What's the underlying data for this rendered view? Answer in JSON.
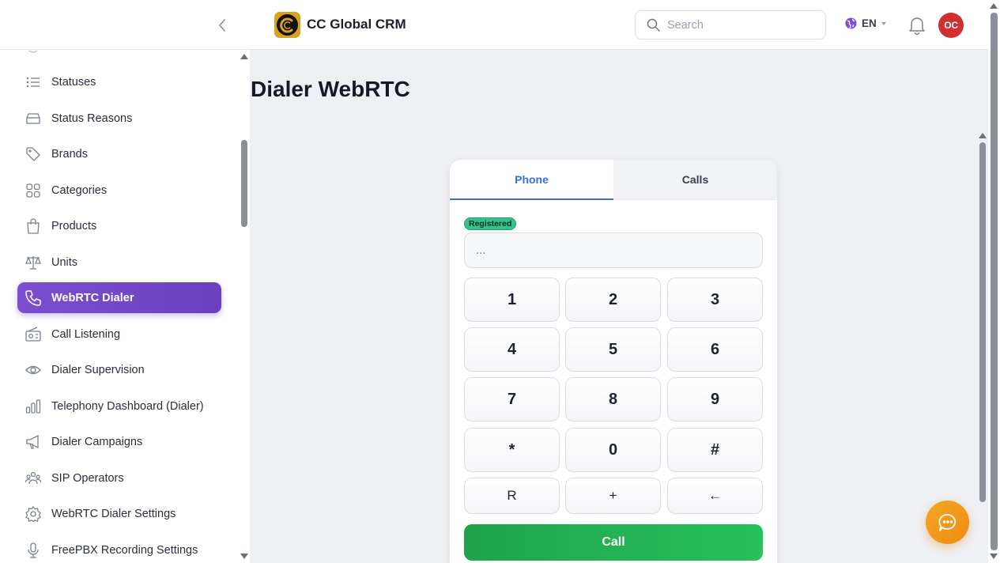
{
  "header": {
    "app_title": "CC Global CRM",
    "search_placeholder": "Search",
    "language": "EN",
    "avatar_initials": "OC"
  },
  "sidebar": {
    "items": [
      {
        "label": "Statuses",
        "icon": "list-icon"
      },
      {
        "label": "Status Reasons",
        "icon": "inbox-icon"
      },
      {
        "label": "Brands",
        "icon": "tag-icon"
      },
      {
        "label": "Categories",
        "icon": "grid-icon"
      },
      {
        "label": "Products",
        "icon": "shopping-bag-icon"
      },
      {
        "label": "Units",
        "icon": "scale-icon"
      },
      {
        "label": "WebRTC Dialer",
        "icon": "phone-icon",
        "active": true
      },
      {
        "label": "Call Listening",
        "icon": "radio-icon"
      },
      {
        "label": "Dialer Supervision",
        "icon": "eye-icon"
      },
      {
        "label": "Telephony Dashboard (Dialer)",
        "icon": "bar-chart-icon"
      },
      {
        "label": "Dialer Campaigns",
        "icon": "megaphone-icon"
      },
      {
        "label": "SIP Operators",
        "icon": "users-icon"
      },
      {
        "label": "WebRTC Dialer Settings",
        "icon": "gear-icon"
      },
      {
        "label": "FreePBX Recording Settings",
        "icon": "microphone-icon"
      }
    ]
  },
  "main": {
    "page_title": "Dialer WebRTC",
    "dialer": {
      "tabs": [
        {
          "label": "Phone",
          "active": true
        },
        {
          "label": "Calls",
          "active": false
        }
      ],
      "status_badge": "Registered",
      "number_placeholder": "...",
      "keys": [
        "1",
        "2",
        "3",
        "4",
        "5",
        "6",
        "7",
        "8",
        "9",
        "*",
        "0",
        "#"
      ],
      "function_keys": [
        "R",
        "+",
        "←"
      ],
      "call_label": "Call"
    }
  },
  "colors": {
    "accent": "#6a3fc0",
    "tab_active": "#3b6fd8",
    "call_green": "#22b455",
    "registered_green": "#34c38f",
    "avatar_red": "#d32f2f",
    "chat_orange": "#f29a1b"
  }
}
